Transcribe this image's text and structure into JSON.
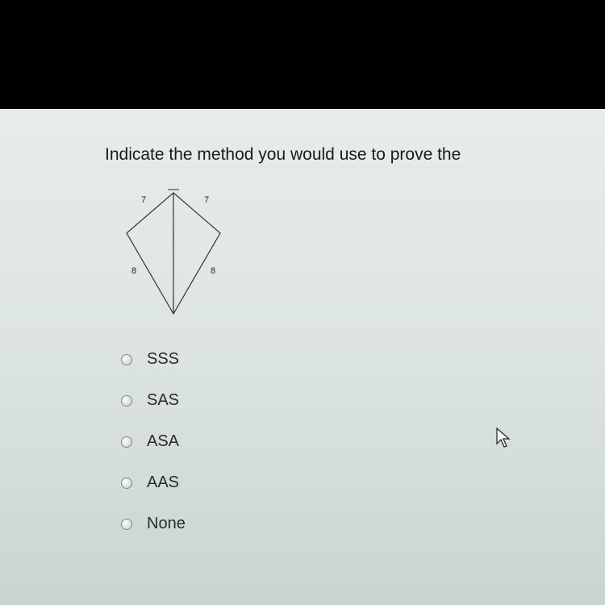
{
  "question": {
    "text": "Indicate the method you would use to prove the"
  },
  "figure": {
    "labels": {
      "top_left": "7",
      "top_right": "7",
      "bottom_left": "8",
      "bottom_right": "8"
    }
  },
  "options": [
    {
      "label": "SSS"
    },
    {
      "label": "SAS"
    },
    {
      "label": "ASA"
    },
    {
      "label": "AAS"
    },
    {
      "label": "None"
    }
  ]
}
